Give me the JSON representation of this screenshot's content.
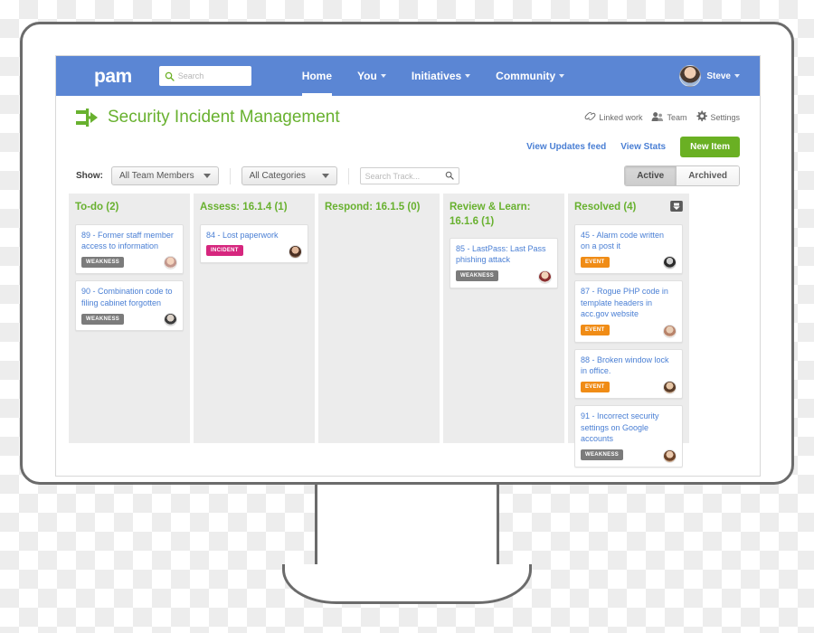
{
  "navbar": {
    "brand": "pam",
    "search_placeholder": "Search",
    "links": [
      {
        "label": "Home",
        "has_caret": false,
        "active": true
      },
      {
        "label": "You",
        "has_caret": true,
        "active": false
      },
      {
        "label": "Initiatives",
        "has_caret": true,
        "active": false
      },
      {
        "label": "Community",
        "has_caret": true,
        "active": false
      }
    ],
    "user_name": "Steve",
    "accent_blue": "#5b86d4"
  },
  "header": {
    "title": "Security Incident Management",
    "title_color": "#68b12f",
    "tools": [
      {
        "label": "Linked work",
        "icon": "link-icon"
      },
      {
        "label": "Team",
        "icon": "people-icon"
      },
      {
        "label": "Settings",
        "icon": "gear-icon"
      }
    ]
  },
  "actions": {
    "updates_feed": "View Updates feed",
    "view_stats": "View Stats",
    "new_item": "New Item",
    "new_item_color": "#6ab023"
  },
  "filters": {
    "show_label": "Show:",
    "team_members": "All Team Members",
    "categories": "All Categories",
    "track_search_placeholder": "Search Track...",
    "segments": [
      {
        "label": "Active",
        "selected": true
      },
      {
        "label": "Archived",
        "selected": false
      }
    ]
  },
  "board": {
    "columns": [
      {
        "title": "To-do (2)",
        "has_archive_icon": false,
        "cards": [
          {
            "title": "89 - Former staff member access to information",
            "tag": "WEAKNESS",
            "tag_type": "weakness",
            "avatar": "av-1"
          },
          {
            "title": "90 - Combination code to filing cabinet forgotten",
            "tag": "WEAKNESS",
            "tag_type": "weakness",
            "avatar": "av-2"
          }
        ]
      },
      {
        "title": "Assess: 16.1.4 (1)",
        "has_archive_icon": false,
        "cards": [
          {
            "title": "84 - Lost paperwork",
            "tag": "INCIDENT",
            "tag_type": "incident",
            "avatar": "av-3"
          }
        ]
      },
      {
        "title": "Respond: 16.1.5 (0)",
        "has_archive_icon": false,
        "cards": []
      },
      {
        "title": "Review & Learn: 16.1.6 (1)",
        "has_archive_icon": false,
        "cards": [
          {
            "title": "85 - LastPass: Last Pass phishing attack",
            "tag": "WEAKNESS",
            "tag_type": "weakness",
            "avatar": "av-4"
          }
        ]
      },
      {
        "title": "Resolved (4)",
        "has_archive_icon": true,
        "cards": [
          {
            "title": "45 - Alarm code written on a post it",
            "tag": "EVENT",
            "tag_type": "event",
            "avatar": "av-5"
          },
          {
            "title": "87 - Rogue PHP code in template headers in acc.gov website",
            "tag": "EVENT",
            "tag_type": "event",
            "avatar": "av-6"
          },
          {
            "title": "88 - Broken window lock in office.",
            "tag": "EVENT",
            "tag_type": "event",
            "avatar": "av-7"
          },
          {
            "title": "91 - Incorrect security settings on Google accounts",
            "tag": "WEAKNESS",
            "tag_type": "weakness",
            "avatar": "av-8"
          }
        ]
      }
    ],
    "tag_colors": {
      "weakness": "#7b7b7b",
      "incident": "#d6267e",
      "event": "#f08c16"
    }
  }
}
